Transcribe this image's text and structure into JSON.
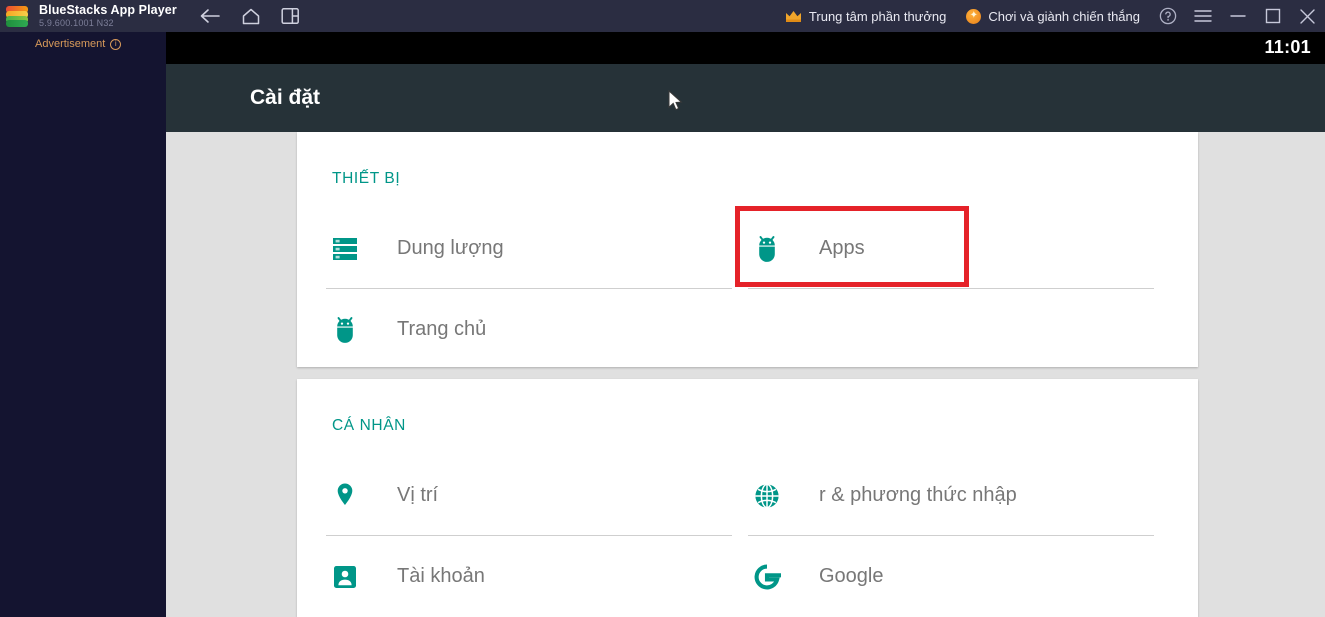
{
  "window": {
    "app_title": "BlueStacks App Player",
    "app_version": "5.9.600.1001  N32",
    "logo_icon": "bluestacks-layers-logo",
    "nav": [
      {
        "name": "back",
        "icon": "arrow-left-icon"
      },
      {
        "name": "home",
        "icon": "home-icon"
      },
      {
        "name": "instances",
        "icon": "multi-instance-icon"
      }
    ],
    "promos": [
      {
        "icon": "crown-icon",
        "label": "Trung tâm phần thưởng"
      },
      {
        "icon": "star-orb-icon",
        "label": "Chơi và giành chiến thắng"
      }
    ],
    "controls": [
      {
        "name": "help",
        "icon": "help-circle-icon"
      },
      {
        "name": "menu",
        "icon": "hamburger-menu-icon"
      },
      {
        "name": "minimize",
        "icon": "minimize-icon"
      },
      {
        "name": "maximize",
        "icon": "maximize-icon"
      },
      {
        "name": "close",
        "icon": "close-icon"
      }
    ]
  },
  "ad_panel": {
    "label": "Advertisement",
    "info_glyph": "i"
  },
  "android": {
    "status_bar": {
      "clock": "11:01"
    },
    "action_bar": {
      "title": "Cài đặt"
    }
  },
  "settings": {
    "sections": [
      {
        "title": "THIẾT BỊ",
        "rows": [
          {
            "icon": "storage-icon",
            "label": "Dung lượng",
            "column": "left",
            "line": 0
          },
          {
            "icon": "android-bug-icon",
            "label": "Apps",
            "column": "right",
            "line": 0
          },
          {
            "icon": "android-bug-icon",
            "label": "Trang chủ",
            "column": "left",
            "line": 1
          }
        ]
      },
      {
        "title": "CÁ NHÂN",
        "rows": [
          {
            "icon": "location-pin-icon",
            "label": "Vị trí",
            "column": "left",
            "line": 0
          },
          {
            "icon": "globe-icon",
            "label": "r & phương thức nhập",
            "column": "right",
            "line": 0
          },
          {
            "icon": "account-box-icon",
            "label": "Tài khoản",
            "column": "left",
            "line": 1
          },
          {
            "icon": "google-g-icon",
            "label": "Google",
            "column": "right",
            "line": 1
          }
        ]
      }
    ]
  },
  "annotation": {
    "highlight_target": "Apps",
    "highlight_color": "#e52229"
  },
  "colors": {
    "accent_teal": "#009688",
    "titlebar": "#2b2d42",
    "actionbar": "#263238",
    "page_bg": "#e0e0e0",
    "ad_bg": "#141430",
    "ad_text": "#d89a5a"
  }
}
